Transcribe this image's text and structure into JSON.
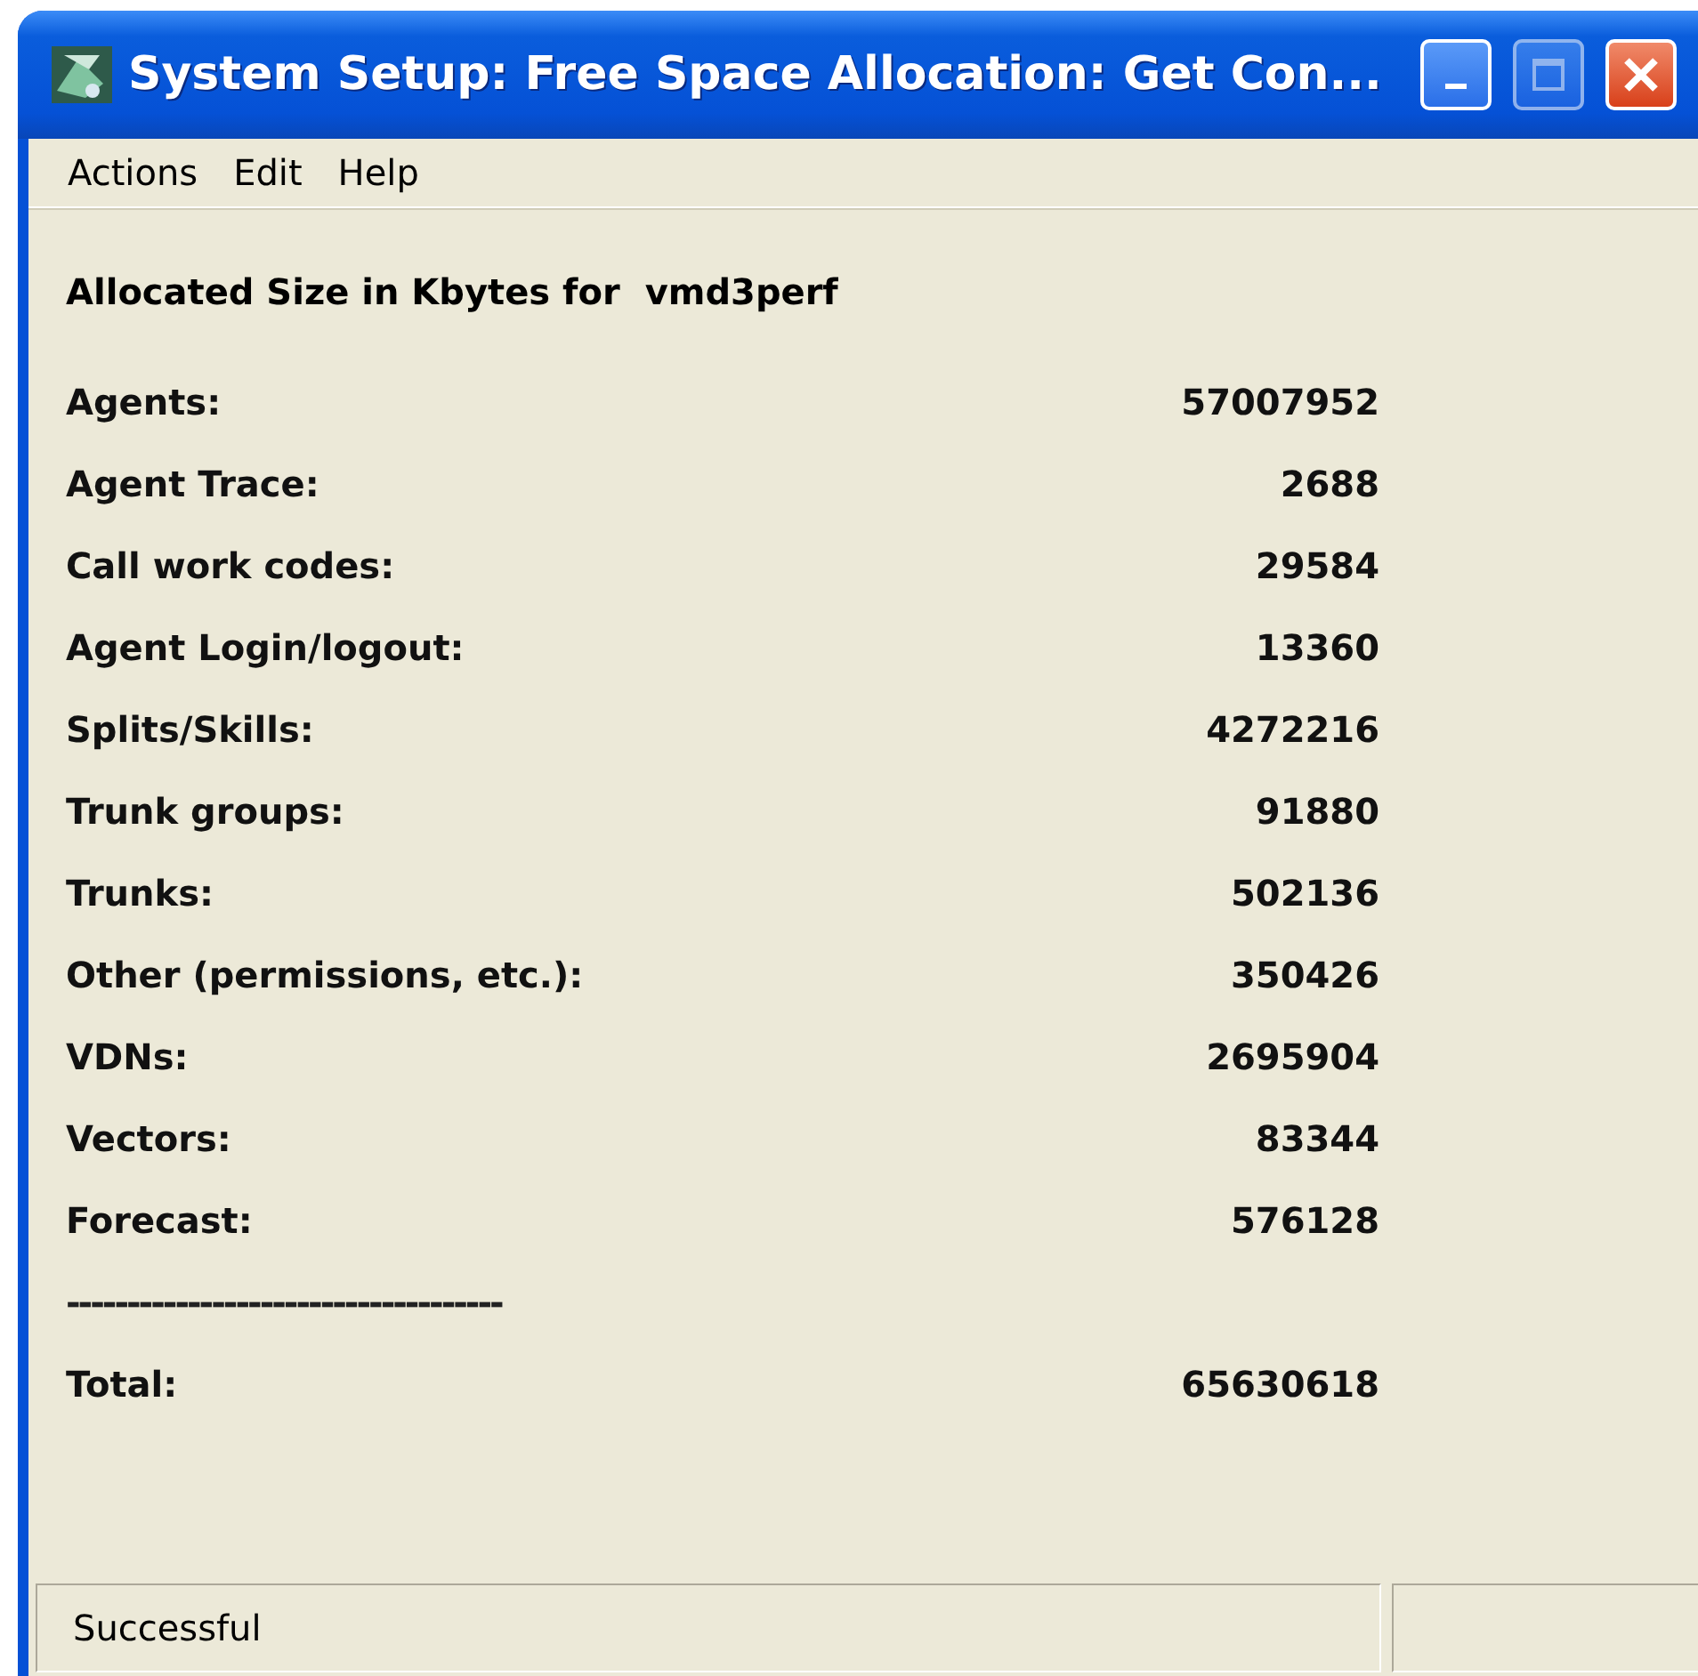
{
  "window": {
    "title": "System Setup: Free Space Allocation: Get Con..."
  },
  "menu": [
    "Actions",
    "Edit",
    "Help"
  ],
  "heading": {
    "label": "Allocated Size in Kbytes for",
    "system": "vmd3perf"
  },
  "rows": [
    {
      "label": "Agents:",
      "value": "57007952"
    },
    {
      "label": "Agent Trace:",
      "value": "2688"
    },
    {
      "label": "Call work codes:",
      "value": "29584"
    },
    {
      "label": "Agent Login/logout:",
      "value": "13360"
    },
    {
      "label": "Splits/Skills:",
      "value": "4272216"
    },
    {
      "label": "Trunk groups:",
      "value": "91880"
    },
    {
      "label": "Trunks:",
      "value": "502136"
    },
    {
      "label": "Other (permissions, etc.):",
      "value": "350426"
    },
    {
      "label": "VDNs:",
      "value": "2695904"
    },
    {
      "label": "Vectors:",
      "value": "83344"
    },
    {
      "label": "Forecast:",
      "value": "576128"
    }
  ],
  "separator": "------------------------------------",
  "total": {
    "label": "Total:",
    "value": "65630618"
  },
  "status_bar": {
    "message": "Successful"
  }
}
